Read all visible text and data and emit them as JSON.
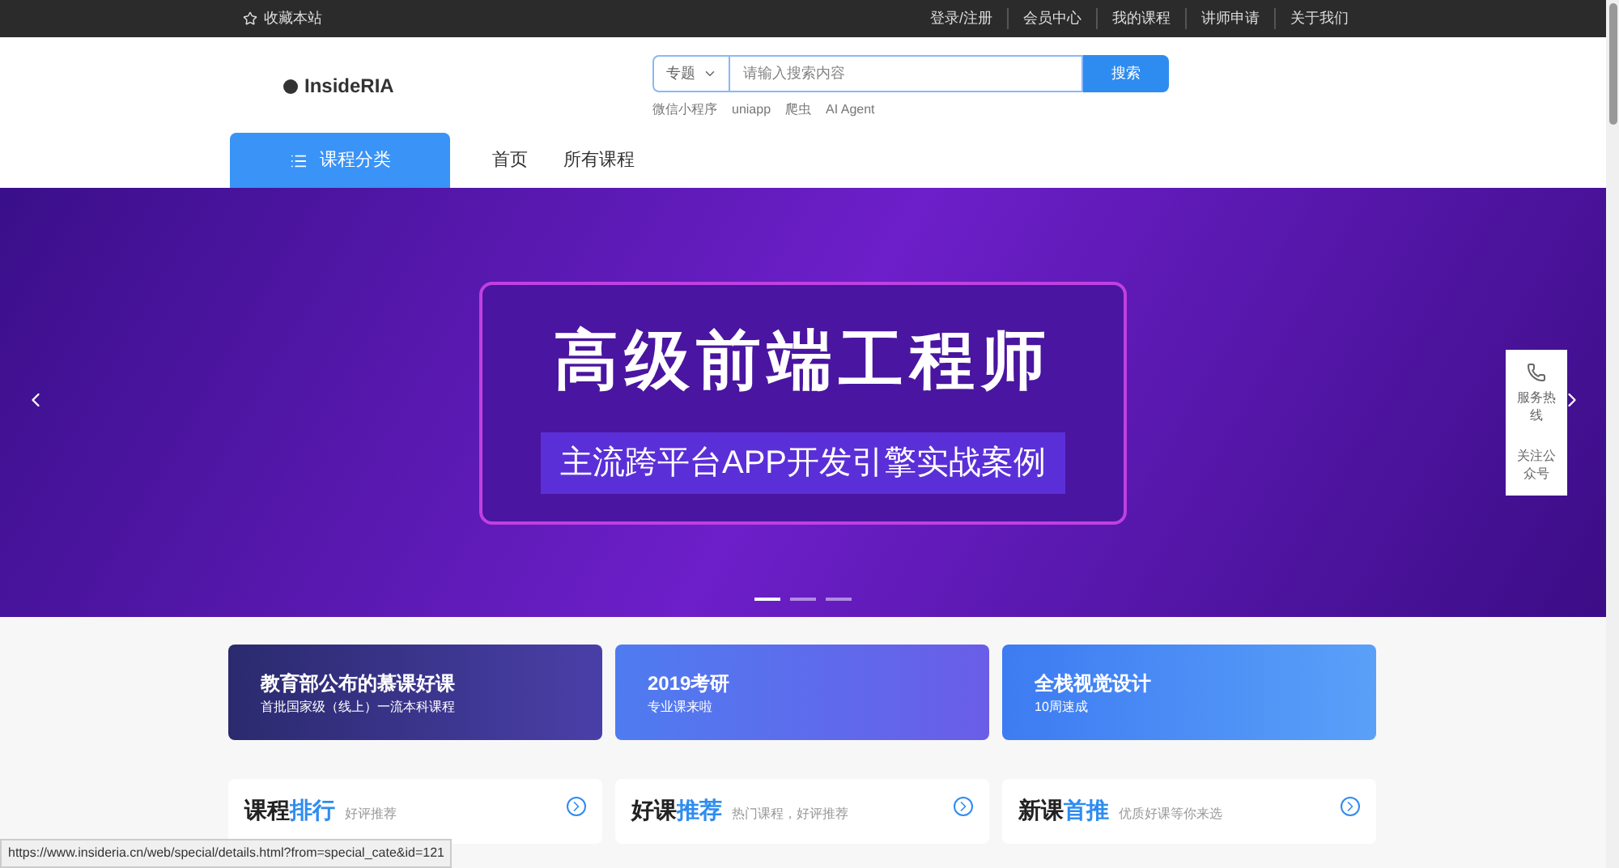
{
  "top_bar": {
    "bookmark": "收藏本站",
    "links": [
      "登录/注册",
      "会员中心",
      "我的课程",
      "讲师申请",
      "关于我们"
    ]
  },
  "header": {
    "logo": "InsideRIA",
    "search": {
      "scope": "专题",
      "placeholder": "请输入搜索内容",
      "button": "搜索"
    },
    "hot_words": [
      "微信小程序",
      "uniapp",
      "爬虫",
      "AI Agent"
    ]
  },
  "nav": {
    "category_button": "课程分类",
    "items": [
      {
        "label": "首页",
        "selected": false
      },
      {
        "label": "所有课程",
        "selected": false
      }
    ]
  },
  "banner": {
    "title": "高级前端工程师",
    "subtitle": "主流跨平台APP开发引擎实战案例",
    "dots": [
      {
        "selected": true
      },
      {
        "selected": false
      },
      {
        "selected": false
      }
    ]
  },
  "side_float": [
    {
      "kind": "phone",
      "label": "服务热线"
    },
    {
      "kind": "text",
      "label": "关注公众号"
    }
  ],
  "promos": [
    {
      "title": "教育部公布的慕课好课",
      "subtitle": "首批国家级（线上）一流本科课程"
    },
    {
      "title": "2019考研",
      "subtitle": "专业课来啦"
    },
    {
      "title": "全栈视觉设计",
      "subtitle": "10周速成"
    }
  ],
  "sections": [
    {
      "title": "课程",
      "accent": "排行",
      "subtitle": "好评推荐"
    },
    {
      "title": "好课",
      "accent": "推荐",
      "subtitle": "热门课程，好评推荐"
    },
    {
      "title": "新课",
      "accent": "首推",
      "subtitle": "优质好课等你来选"
    }
  ],
  "status_bar": {
    "url": "https://www.insideria.cn/web/special/details.html?from=special_cate&id=121"
  }
}
